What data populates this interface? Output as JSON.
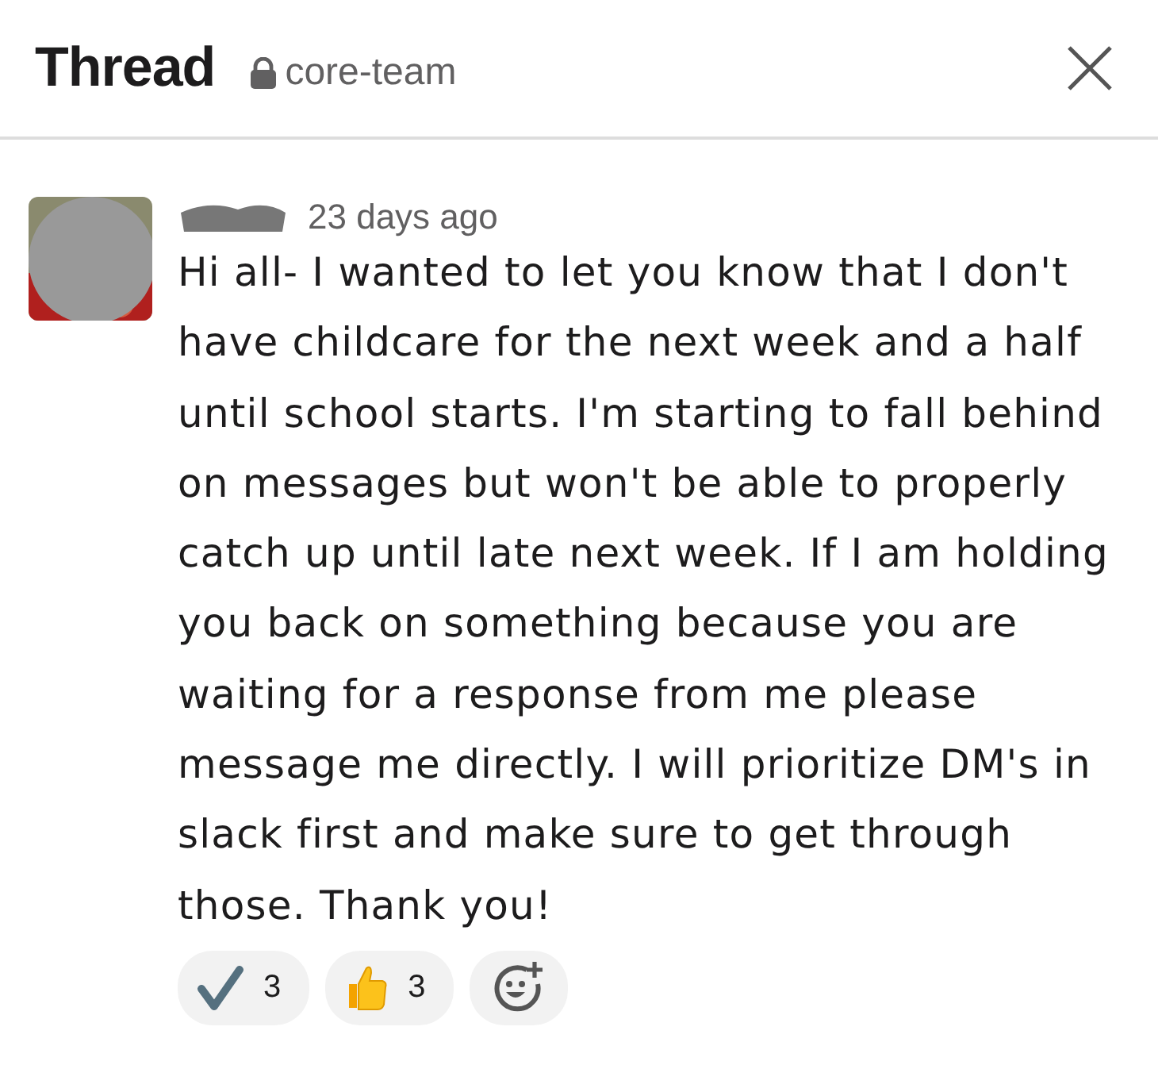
{
  "header": {
    "title": "Thread",
    "channel": "core-team",
    "private": true
  },
  "message": {
    "time": "23 days ago",
    "text": "Hi all- I wanted to let you know that I don't have childcare for the next week and a half until school starts. I'm starting to fall behind on messages but won't be able to properly catch up until late next week. If I am holding you back on something because you are waiting for a response from me please message me directly. I will prioritize DM's in slack first and make sure to get through those. Thank you!",
    "reactions": [
      {
        "kind": "check",
        "count": "3"
      },
      {
        "kind": "thumbs-up",
        "count": "3"
      },
      {
        "kind": "add"
      }
    ]
  }
}
